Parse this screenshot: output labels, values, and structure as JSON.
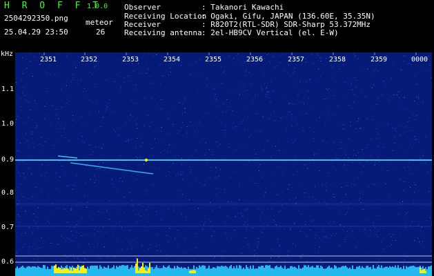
{
  "header": {
    "app_title": "H R O F F T",
    "app_version": "1.0.0",
    "filename": "2504292350.png",
    "datetime": "25.04.29 23:50",
    "meteor_label": "meteor",
    "meteor_count": "26"
  },
  "info": [
    {
      "label": "Observer",
      "value": ": Takanori Kawachi"
    },
    {
      "label": "Receiving Location",
      "value": ": Ogaki, Gifu, JAPAN (136.60E, 35.35N)"
    },
    {
      "label": "Receiver",
      "value": ": R820T2(RTL-SDR) SDR-Sharp 53.372MHz"
    },
    {
      "label": "Receiving antenna",
      "value": ": 2el-HB9CV Vertical (el. E-W)"
    }
  ],
  "axis": {
    "y_unit": "kHz",
    "y_ticks": [
      "1.1",
      "1.0",
      "0.9",
      "0.8",
      "0.7",
      "0.6"
    ],
    "x_ticks": [
      "2351",
      "2352",
      "2353",
      "2354",
      "2355",
      "2356",
      "2357",
      "2358",
      "2359",
      "0000"
    ]
  },
  "colors": {
    "title_green": "#34ff34",
    "background_blue": "#061a78",
    "trace_cyan": "#2fd0ff",
    "burst_yellow": "#f4ef18"
  }
}
